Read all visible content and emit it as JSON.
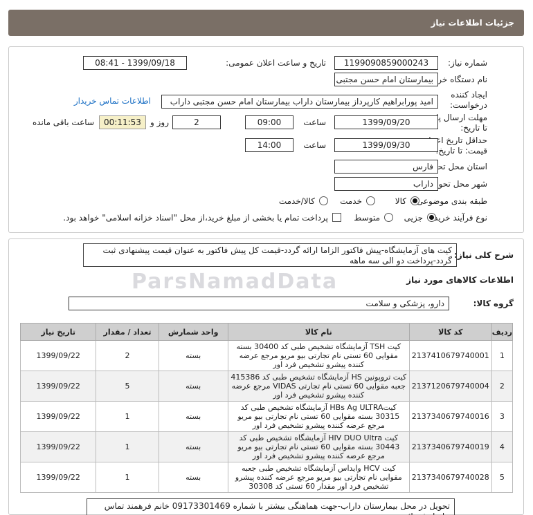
{
  "header": {
    "title": "جزئیات اطلاعات نیاز"
  },
  "form": {
    "need_number_label": "شماره نیاز:",
    "need_number": "1199090859000243",
    "announce_label": "تاریخ و ساعت اعلان عمومی:",
    "announce_value": "1399/09/18 - 08:41",
    "buyer_label": "نام دستگاه خریدار:",
    "buyer_value": "بیمارستان امام حسن مجتبی داراب",
    "creator_label_1": "ایجاد کننده",
    "creator_label_2": "درخواست:",
    "creator_value": "امید پورابراهیم کارپرداز بیمارستان داراب بیمارستان امام حسن مجتبی داراب",
    "contact_link": "اطلاعات تماس خریدار",
    "reply_label_1": "مهلت ارسال پاسخ:",
    "reply_label_2": "تا تاریخ:",
    "reply_date": "1399/09/20",
    "time_label": "ساعت",
    "reply_time": "09:00",
    "days_value": "2",
    "day_label": "روز و",
    "remaining_time": "00:11:53",
    "remaining_label": "ساعت باقی مانده",
    "validity_label_1": "حداقل تاریخ اعتبار",
    "validity_label_2": "قیمت: تا تاریخ:",
    "validity_date": "1399/09/30",
    "validity_time": "14:00",
    "province_label": "استان محل تحویل:",
    "province_value": "فارس",
    "city_label": "شهر محل تحویل:",
    "city_value": "داراب",
    "category_label": "طبقه بندی موضوعی:",
    "cat_goods": "کالا",
    "cat_service": "خدمت",
    "cat_goods_service": "کالا/خدمت",
    "process_label": "نوع فرآیند خرید :",
    "proc_partial": "جزیی",
    "proc_medium": "متوسط",
    "payment_note": "پرداخت تمام یا بخشی از مبلغ خرید،از محل \"اسناد خزانه اسلامی\" خواهد بود."
  },
  "summary": {
    "label": "شرح کلی نیاز:",
    "text": "کیت های آزمایشگاه-پیش فاکتور الزاما ارائه گردد-قیمت کل پیش فاکتور به عنوان قیمت پیشنهادی ثبت گردد-پرداخت دو الی سه ماهه"
  },
  "goods": {
    "section_title": "اطلاعات کالاهای مورد نیاز",
    "group_label": "گروه کالا:",
    "group_value": "دارو، پزشکی و سلامت"
  },
  "table": {
    "headers": [
      "ردیف",
      "کد کالا",
      "نام کالا",
      "واحد شمارش",
      "تعداد / مقدار",
      "تاریخ نیاز"
    ],
    "rows": [
      {
        "n": "1",
        "code": "2137410679740001",
        "name": "کیت TSH آزمایشگاه تشخیص طبی کد 30400 بسته مقوایی 60 تستی نام تجارتی بیو مریو مرجع عرضه کننده پیشرو تشخیص فرد اور",
        "unit": "بسته",
        "qty": "2",
        "date": "1399/09/22"
      },
      {
        "n": "2",
        "code": "2137120679740004",
        "name": "کیت تروپونین HS آزمایشگاه تشخیص طبی کد 415386 جعبه مقوایی 60 تستی نام تجارتی VIDAS مرجع عرضه کننده پیشرو تشخیص فرد اور",
        "unit": "بسته",
        "qty": "5",
        "date": "1399/09/22"
      },
      {
        "n": "3",
        "code": "2137340679740016",
        "name": "کیتHBs Ag ULTRA آزمایشگاه تشخیص طبی کد 30315 بسته مقوایی 60 تستی نام تجارتی بیو مریو مرجع عرضه کننده پیشرو تشخیص فرد اور",
        "unit": "بسته",
        "qty": "1",
        "date": "1399/09/22"
      },
      {
        "n": "4",
        "code": "2137340679740019",
        "name": "کیت HIV DUO Ultra آزمایشگاه تشخیص طبی کد 30443 بسته مقوایی 60 تستی نام تجارتی بیو مریو مرجع عرضه کننده پیشرو تشخیص فرد اور",
        "unit": "بسته",
        "qty": "1",
        "date": "1399/09/22"
      },
      {
        "n": "5",
        "code": "2137340679740028",
        "name": "کیت HCV وایداس آزمایشگاه تشخیص طبی جعبه مقوایی نام تجارتی بیو مریو مرجع عرضه کننده پیشرو تشخیص فرد اور مقدار 60 تستی کد 30308",
        "unit": "بسته",
        "qty": "1",
        "date": "1399/09/22"
      }
    ]
  },
  "note": {
    "text": "تحویل در محل بیمارستان داراب-جهت هماهنگی بیشتر با شماره 09173301469 خانم فرهمند تماس حاصل فرمائید"
  },
  "watermark": {
    "text": "ParsNamadData"
  }
}
